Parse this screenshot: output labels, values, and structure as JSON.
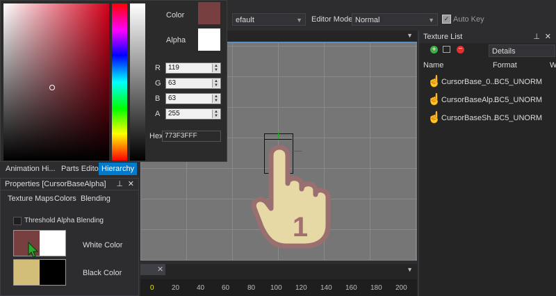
{
  "toolbar": {
    "preset_value": "efault",
    "editor_mode_label": "Editor Mode:",
    "editor_mode_value": "Normal",
    "auto_key_label": "Auto Key"
  },
  "color_picker": {
    "color_label": "Color",
    "alpha_label": "Alpha",
    "color_swatch": "#773F3F",
    "r_label": "R",
    "r_value": "119",
    "g_label": "G",
    "g_value": "63",
    "b_label": "B",
    "b_value": "63",
    "a_label": "A",
    "a_value": "255",
    "hex_label": "Hex",
    "hex_value": "773F3FFF"
  },
  "left_tabs": [
    "Animation Hi...",
    "Parts Editor",
    "Hierarchy"
  ],
  "properties": {
    "title": "Properties [CursorBaseAlpha]",
    "subtabs": [
      "Texture Maps",
      "Colors",
      "Blending"
    ],
    "threshold_label": "Threshold Alpha Blending",
    "white_color_label": "White Color",
    "black_color_label": "Black Color",
    "white_left": "#773F3F",
    "white_right": "#FFFFFF",
    "black_left": "#D2BE78",
    "black_right": "#000000"
  },
  "texture_list": {
    "title": "Texture List",
    "view_value": "Details",
    "col_name": "Name",
    "col_format": "Format",
    "col_extra": "W",
    "rows": [
      {
        "name": "CursorBase_0...",
        "format": "BC5_UNORM"
      },
      {
        "name": "CursorBaseAlp...",
        "format": "BC5_UNORM"
      },
      {
        "name": "CursorBaseSh...",
        "format": "BC5_UNORM"
      }
    ]
  },
  "viewport": {
    "cursor_number": "1"
  },
  "timeline": {
    "ruler": [
      "0",
      "20",
      "40",
      "60",
      "80",
      "100",
      "120",
      "140",
      "160",
      "180",
      "200"
    ]
  }
}
